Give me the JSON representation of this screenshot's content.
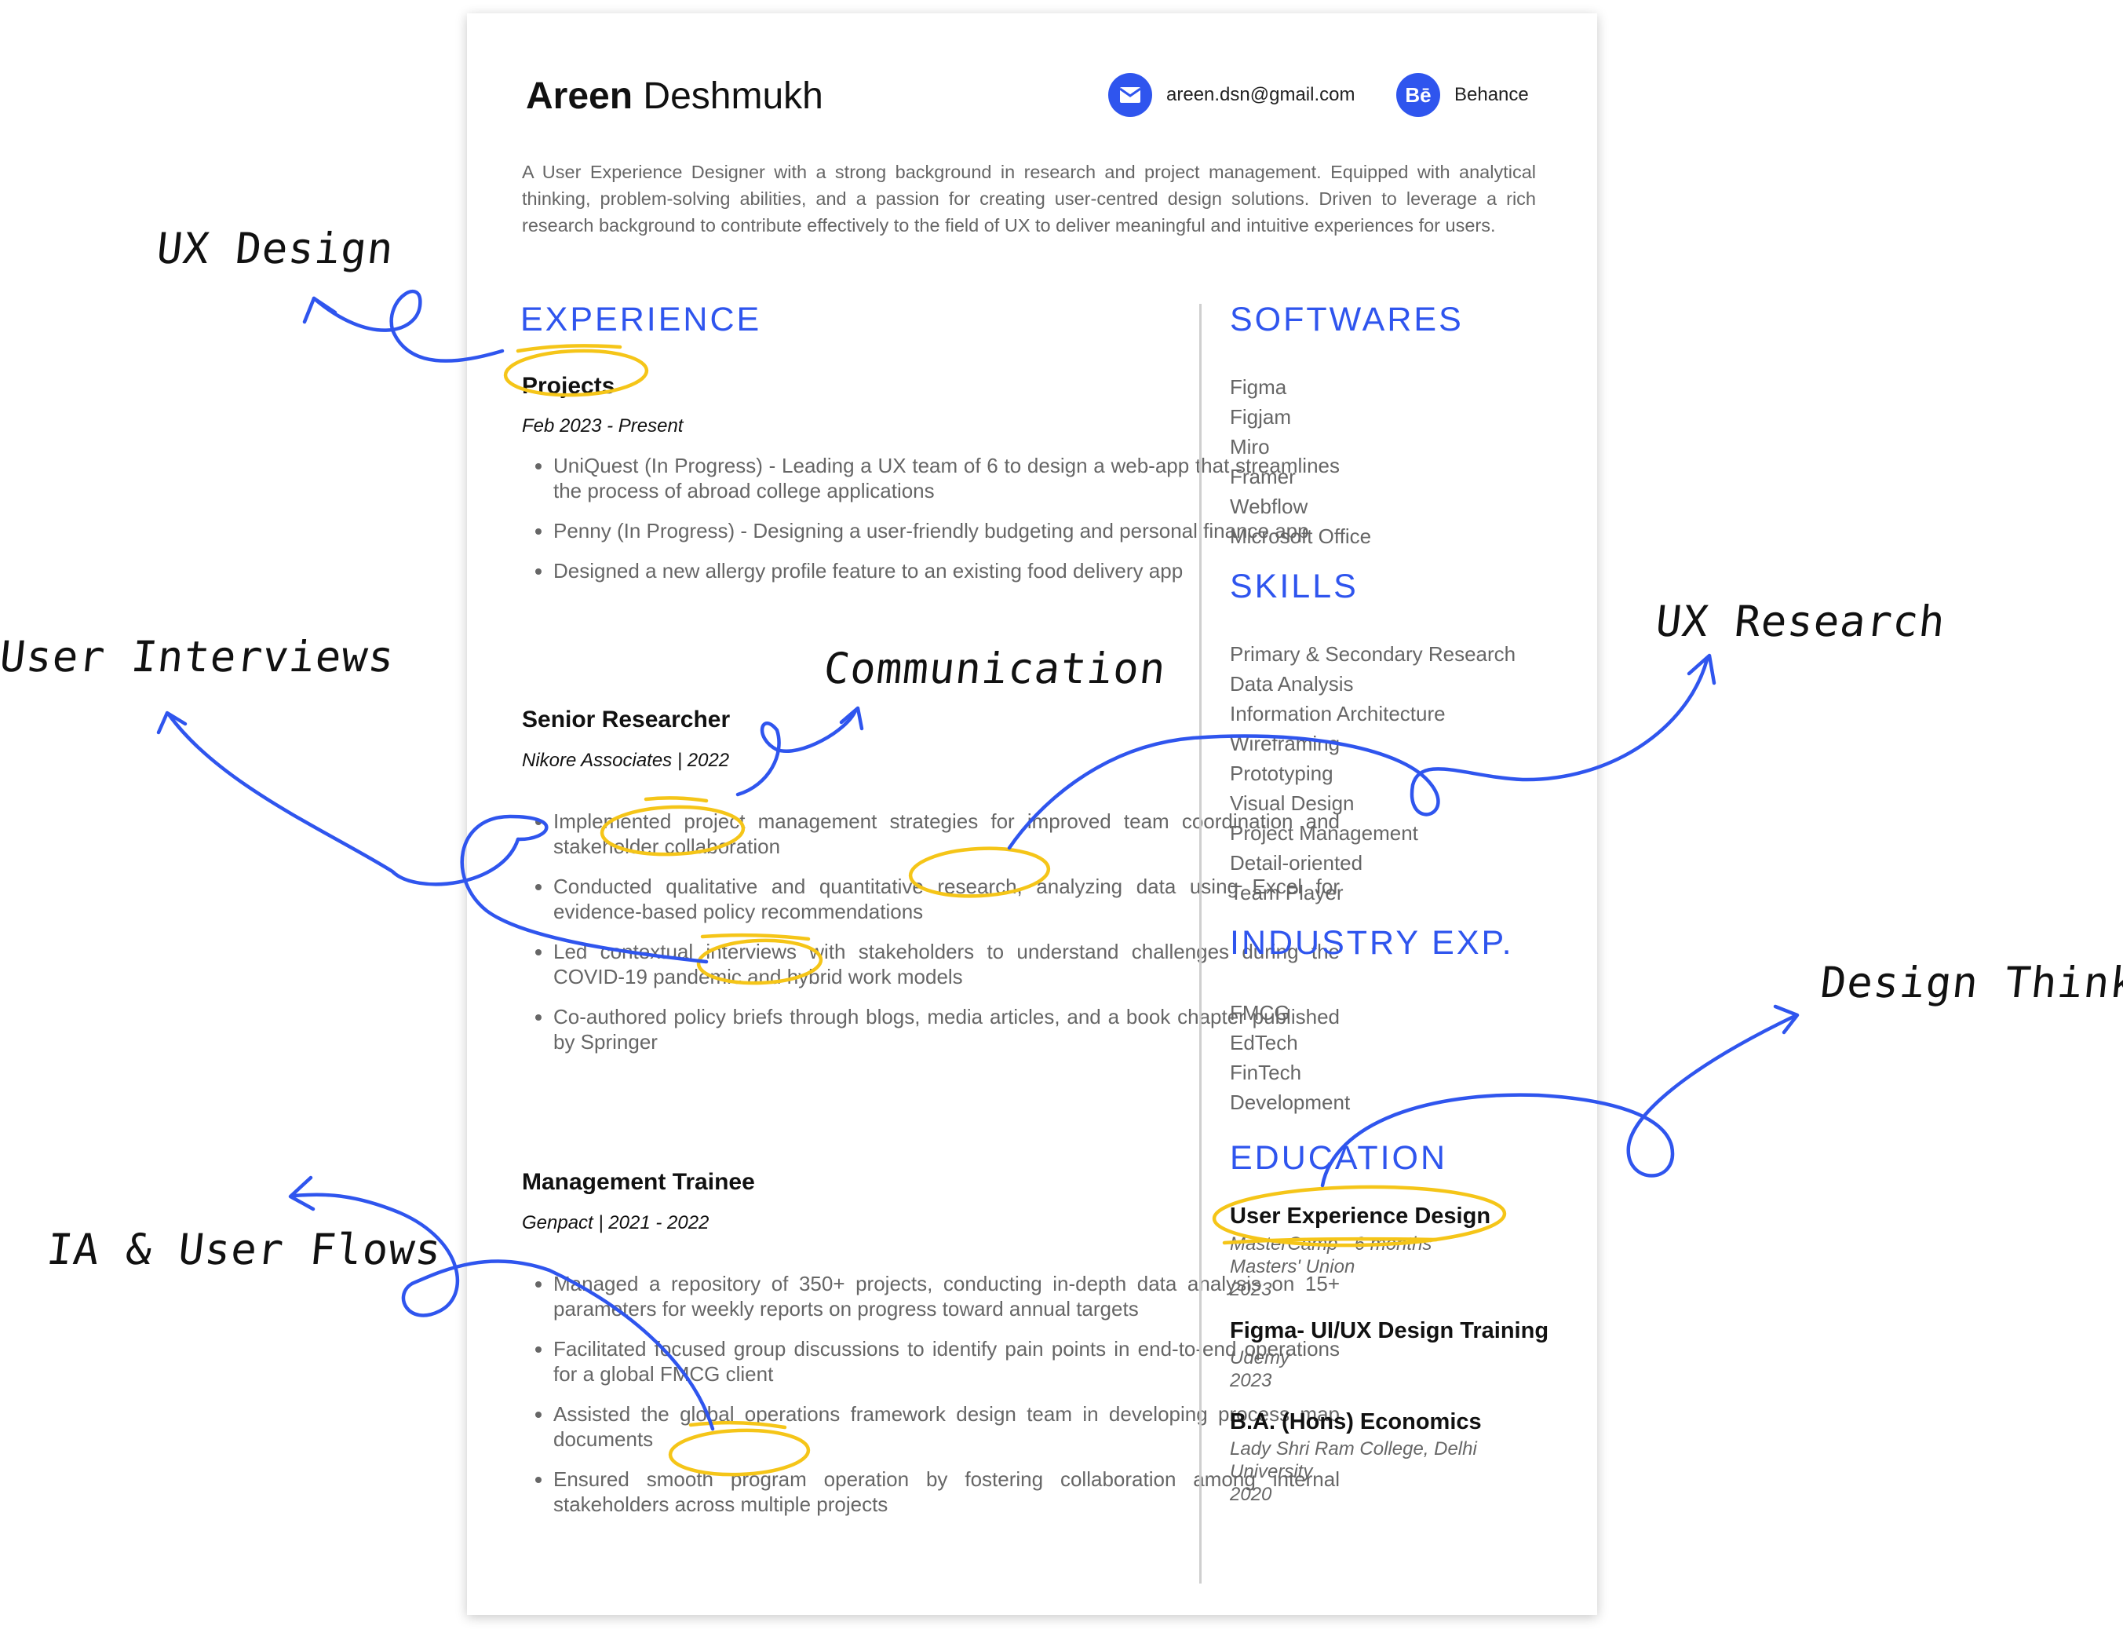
{
  "header": {
    "first_name": "Areen",
    "last_name": "Deshmukh",
    "email": "areen.dsn@gmail.com",
    "email_icon": "mail-icon",
    "behance_label": "Behance",
    "behance_icon": "behance-icon",
    "behance_glyph": "Bē"
  },
  "summary": "A User Experience Designer with a strong background in research and project management. Equipped with analytical thinking, problem-solving abilities, and a passion for creating user-centred design solutions. Driven to leverage a rich research background to contribute effectively to the field of UX to deliver meaningful and intuitive experiences for users.",
  "experience": {
    "heading": "EXPERIENCE",
    "jobs": [
      {
        "title": "Projects",
        "meta": "Feb 2023 - Present",
        "bullets": [
          "UniQuest (In Progress) - Leading a UX team of 6 to design a web-app that streamlines the process of abroad college applications",
          "Penny (In Progress) - Designing a user-friendly budgeting and personal finance app",
          "Designed a new allergy profile feature to an existing food delivery app"
        ]
      },
      {
        "title": "Senior Researcher",
        "meta": "Nikore Associates | 2022",
        "bullets": [
          "Implemented project management strategies for improved team coordination and stakeholder collaboration",
          "Conducted qualitative and quantitative research, analyzing data using Excel for evidence-based policy recommendations",
          "Led contextual interviews with stakeholders to understand challenges during the COVID-19 pandemic and hybrid work models",
          "Co-authored policy briefs through blogs, media articles, and a book chapter published by Springer"
        ]
      },
      {
        "title": "Management Trainee",
        "meta": "Genpact | 2021 - 2022",
        "bullets": [
          "Managed a repository of 350+ projects, conducting in-depth data analysis on 15+ parameters for weekly reports on progress toward annual targets",
          "Facilitated focused group discussions to identify pain points in end-to-end operations for a global FMCG client",
          "Assisted the global operations framework design team in developing process map documents",
          "Ensured smooth program operation by fostering collaboration among internal stakeholders across multiple projects"
        ]
      }
    ]
  },
  "softwares": {
    "heading": "SOFTWARES",
    "items": [
      "Figma",
      "Figjam",
      "Miro",
      "Framer",
      "Webflow",
      "Microsoft Office"
    ]
  },
  "skills": {
    "heading": "SKILLS",
    "items": [
      "Primary & Secondary Research",
      "Data Analysis",
      "Information Architecture",
      "Wireframing",
      "Prototyping",
      "Visual Design",
      "Project Management",
      "Detail-oriented",
      "Team Player"
    ]
  },
  "industry": {
    "heading": "INDUSTRY EXP.",
    "items": [
      "FMCG",
      "EdTech",
      "FinTech",
      "Development"
    ]
  },
  "education": {
    "heading": "EDUCATION",
    "entries": [
      {
        "title": "User Experience Design",
        "lines": [
          "MasterCamp - 6 months",
          "Masters' Union",
          "2023"
        ]
      },
      {
        "title": "Figma- UI/UX Design Training",
        "lines": [
          "Udemy",
          "2023"
        ]
      },
      {
        "title": "B.A. (Hons) Economics",
        "lines": [
          "Lady Shri Ram College, Delhi University",
          "2020"
        ]
      }
    ]
  },
  "annotations": {
    "ux_design": "UX Design",
    "user_interviews": "User Interviews",
    "communication": "Communication",
    "ux_research": "UX Research",
    "design_thinking": "Design Thinking",
    "ia_user_flows": "IA & User Flows"
  },
  "colors": {
    "accent": "#2f55ee",
    "highlight": "#f5c518",
    "text_dark": "#111111",
    "text_muted": "#666666"
  }
}
